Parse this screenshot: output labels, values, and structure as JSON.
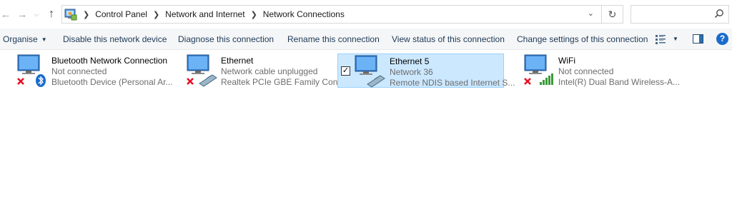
{
  "address_bar": {
    "breadcrumbs": [
      "Control Panel",
      "Network and Internet",
      "Network Connections"
    ],
    "search_placeholder": ""
  },
  "toolbar": {
    "organise": "Organise",
    "disable": "Disable this network device",
    "diagnose": "Diagnose this connection",
    "rename": "Rename this connection",
    "view_status": "View status of this connection",
    "change_settings": "Change settings of this connection"
  },
  "connections": [
    {
      "name": "Bluetooth Network Connection",
      "status": "Not connected",
      "device": "Bluetooth Device (Personal Ar...",
      "icon": "bluetooth-icon",
      "disconnected": true,
      "selected": false
    },
    {
      "name": "Ethernet",
      "status": "Network cable unplugged",
      "device": "Realtek PCIe GBE Family Cont...",
      "icon": "ethernet-cable-icon",
      "disconnected": true,
      "selected": false
    },
    {
      "name": "Ethernet 5",
      "status": "Network 36",
      "device": "Remote NDIS based Internet S...",
      "icon": "ethernet-cable-icon",
      "disconnected": false,
      "selected": true
    },
    {
      "name": "WiFi",
      "status": "Not connected",
      "device": "Intel(R) Dual Band Wireless-A...",
      "icon": "wifi-signal-icon",
      "disconnected": true,
      "selected": false
    }
  ],
  "colors": {
    "selection_bg": "#cce8ff",
    "selection_border": "#99d1ff",
    "toolbar_text": "#1e3957",
    "secondary_text": "#6d6d6d",
    "error_x": "#e81123",
    "help_blue": "#1a6ccc"
  }
}
